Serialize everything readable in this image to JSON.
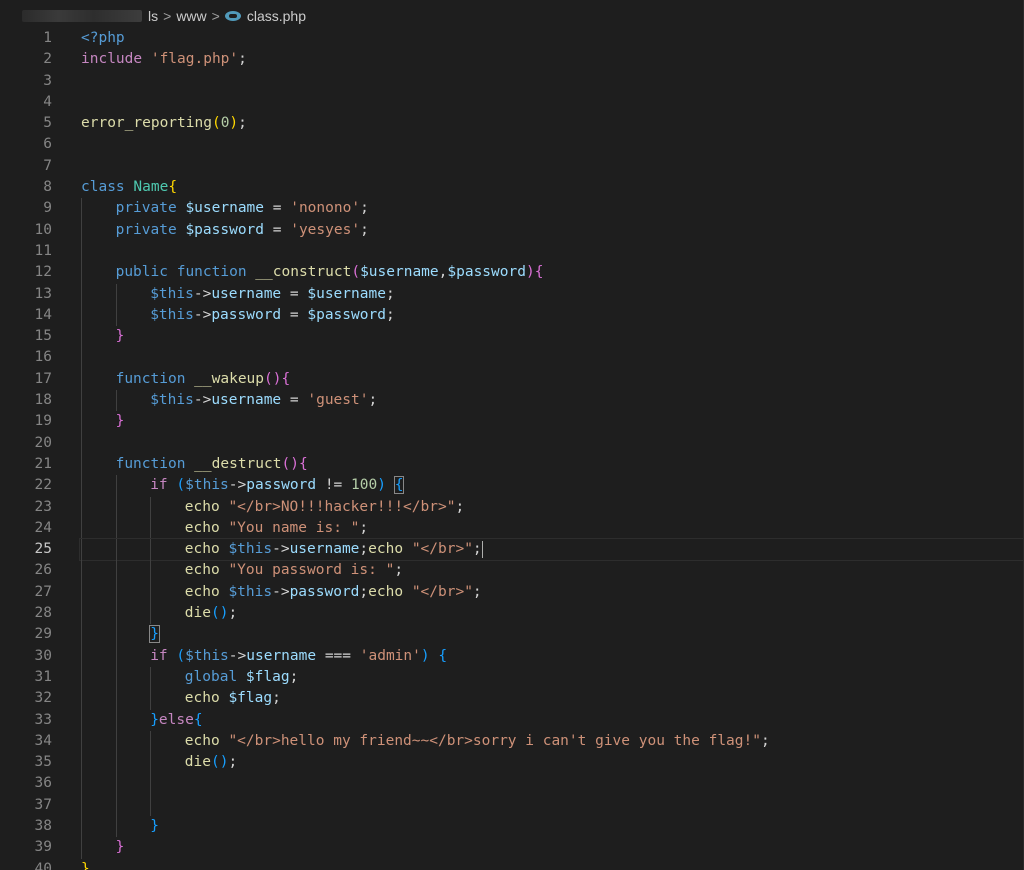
{
  "breadcrumb": {
    "segments": [
      "ls",
      "www"
    ],
    "file_icon": "php-file-icon",
    "file_name": "class.php",
    "separator": ">"
  },
  "editor": {
    "current_line": 25,
    "lines": [
      {
        "n": "1",
        "indent": 0,
        "tokens": [
          [
            "t-kw",
            "<?php"
          ]
        ]
      },
      {
        "n": "2",
        "indent": 0,
        "tokens": [
          [
            "t-ctl",
            "include"
          ],
          [
            "t-pl",
            " "
          ],
          [
            "t-str",
            "'flag.php'"
          ],
          [
            "t-pl",
            ";"
          ]
        ]
      },
      {
        "n": "3",
        "indent": 0,
        "tokens": []
      },
      {
        "n": "4",
        "indent": 0,
        "tokens": []
      },
      {
        "n": "5",
        "indent": 0,
        "tokens": [
          [
            "t-fn",
            "error_reporting"
          ],
          [
            "t-y",
            "("
          ],
          [
            "t-num",
            "0"
          ],
          [
            "t-y",
            ")"
          ],
          [
            "t-pl",
            ";"
          ]
        ]
      },
      {
        "n": "6",
        "indent": 0,
        "tokens": []
      },
      {
        "n": "7",
        "indent": 0,
        "tokens": []
      },
      {
        "n": "8",
        "indent": 0,
        "tokens": [
          [
            "t-kw",
            "class"
          ],
          [
            "t-pl",
            " "
          ],
          [
            "t-cls",
            "Name"
          ],
          [
            "t-y",
            "{"
          ]
        ]
      },
      {
        "n": "9",
        "indent": 1,
        "tokens": [
          [
            "t-kw",
            "private"
          ],
          [
            "t-pl",
            " "
          ],
          [
            "t-var",
            "$username"
          ],
          [
            "t-pl",
            " = "
          ],
          [
            "t-str",
            "'nonono'"
          ],
          [
            "t-pl",
            ";"
          ]
        ]
      },
      {
        "n": "10",
        "indent": 1,
        "tokens": [
          [
            "t-kw",
            "private"
          ],
          [
            "t-pl",
            " "
          ],
          [
            "t-var",
            "$password"
          ],
          [
            "t-pl",
            " = "
          ],
          [
            "t-str",
            "'yesyes'"
          ],
          [
            "t-pl",
            ";"
          ]
        ]
      },
      {
        "n": "11",
        "indent": 1,
        "tokens": []
      },
      {
        "n": "12",
        "indent": 1,
        "tokens": [
          [
            "t-kw",
            "public"
          ],
          [
            "t-pl",
            " "
          ],
          [
            "t-kw",
            "function"
          ],
          [
            "t-pl",
            " "
          ],
          [
            "t-fn",
            "__construct"
          ],
          [
            "t-p",
            "("
          ],
          [
            "t-var",
            "$username"
          ],
          [
            "t-pl",
            ","
          ],
          [
            "t-var",
            "$password"
          ],
          [
            "t-p",
            ")"
          ],
          [
            "t-p",
            "{"
          ]
        ]
      },
      {
        "n": "13",
        "indent": 2,
        "tokens": [
          [
            "t-kw",
            "$this"
          ],
          [
            "t-pl",
            "->"
          ],
          [
            "t-var",
            "username"
          ],
          [
            "t-pl",
            " = "
          ],
          [
            "t-var",
            "$username"
          ],
          [
            "t-pl",
            ";"
          ]
        ]
      },
      {
        "n": "14",
        "indent": 2,
        "tokens": [
          [
            "t-kw",
            "$this"
          ],
          [
            "t-pl",
            "->"
          ],
          [
            "t-var",
            "password"
          ],
          [
            "t-pl",
            " = "
          ],
          [
            "t-var",
            "$password"
          ],
          [
            "t-pl",
            ";"
          ]
        ]
      },
      {
        "n": "15",
        "indent": 1,
        "tokens": [
          [
            "t-p",
            "}"
          ]
        ]
      },
      {
        "n": "16",
        "indent": 1,
        "tokens": []
      },
      {
        "n": "17",
        "indent": 1,
        "tokens": [
          [
            "t-kw",
            "function"
          ],
          [
            "t-pl",
            " "
          ],
          [
            "t-fn",
            "__wakeup"
          ],
          [
            "t-p",
            "()"
          ],
          [
            "t-p",
            "{"
          ]
        ]
      },
      {
        "n": "18",
        "indent": 2,
        "tokens": [
          [
            "t-kw",
            "$this"
          ],
          [
            "t-pl",
            "->"
          ],
          [
            "t-var",
            "username"
          ],
          [
            "t-pl",
            " = "
          ],
          [
            "t-str",
            "'guest'"
          ],
          [
            "t-pl",
            ";"
          ]
        ]
      },
      {
        "n": "19",
        "indent": 1,
        "tokens": [
          [
            "t-p",
            "}"
          ]
        ]
      },
      {
        "n": "20",
        "indent": 1,
        "tokens": []
      },
      {
        "n": "21",
        "indent": 1,
        "tokens": [
          [
            "t-kw",
            "function"
          ],
          [
            "t-pl",
            " "
          ],
          [
            "t-fn",
            "__destruct"
          ],
          [
            "t-p",
            "()"
          ],
          [
            "t-p",
            "{"
          ]
        ]
      },
      {
        "n": "22",
        "indent": 2,
        "tokens": [
          [
            "t-ctl",
            "if"
          ],
          [
            "t-pl",
            " "
          ],
          [
            "t-b",
            "("
          ],
          [
            "t-kw",
            "$this"
          ],
          [
            "t-pl",
            "->"
          ],
          [
            "t-var",
            "password"
          ],
          [
            "t-pl",
            " != "
          ],
          [
            "t-num",
            "100"
          ],
          [
            "t-b",
            ")"
          ],
          [
            "t-pl",
            " "
          ],
          [
            "t-b bm",
            "{"
          ]
        ]
      },
      {
        "n": "23",
        "indent": 3,
        "tokens": [
          [
            "t-fn",
            "echo"
          ],
          [
            "t-pl",
            " "
          ],
          [
            "t-str",
            "\"</br>NO!!!hacker!!!</br>\""
          ],
          [
            "t-pl",
            ";"
          ]
        ]
      },
      {
        "n": "24",
        "indent": 3,
        "tokens": [
          [
            "t-fn",
            "echo"
          ],
          [
            "t-pl",
            " "
          ],
          [
            "t-str",
            "\"You name is: \""
          ],
          [
            "t-pl",
            ";"
          ]
        ]
      },
      {
        "n": "25",
        "indent": 3,
        "tokens": [
          [
            "t-fn",
            "echo"
          ],
          [
            "t-pl",
            " "
          ],
          [
            "t-kw",
            "$this"
          ],
          [
            "t-pl",
            "->"
          ],
          [
            "t-var",
            "username"
          ],
          [
            "t-pl",
            ";"
          ],
          [
            "t-fn",
            "echo"
          ],
          [
            "t-pl",
            " "
          ],
          [
            "t-str",
            "\"</br>\""
          ],
          [
            "t-pl",
            ";"
          ]
        ]
      },
      {
        "n": "26",
        "indent": 3,
        "tokens": [
          [
            "t-fn",
            "echo"
          ],
          [
            "t-pl",
            " "
          ],
          [
            "t-str",
            "\"You password is: \""
          ],
          [
            "t-pl",
            ";"
          ]
        ]
      },
      {
        "n": "27",
        "indent": 3,
        "tokens": [
          [
            "t-fn",
            "echo"
          ],
          [
            "t-pl",
            " "
          ],
          [
            "t-kw",
            "$this"
          ],
          [
            "t-pl",
            "->"
          ],
          [
            "t-var",
            "password"
          ],
          [
            "t-pl",
            ";"
          ],
          [
            "t-fn",
            "echo"
          ],
          [
            "t-pl",
            " "
          ],
          [
            "t-str",
            "\"</br>\""
          ],
          [
            "t-pl",
            ";"
          ]
        ]
      },
      {
        "n": "28",
        "indent": 3,
        "tokens": [
          [
            "t-fn",
            "die"
          ],
          [
            "t-b",
            "()"
          ],
          [
            "t-pl",
            ";"
          ]
        ]
      },
      {
        "n": "29",
        "indent": 2,
        "tokens": [
          [
            "t-b bm",
            "}"
          ]
        ]
      },
      {
        "n": "30",
        "indent": 2,
        "tokens": [
          [
            "t-ctl",
            "if"
          ],
          [
            "t-pl",
            " "
          ],
          [
            "t-b",
            "("
          ],
          [
            "t-kw",
            "$this"
          ],
          [
            "t-pl",
            "->"
          ],
          [
            "t-var",
            "username"
          ],
          [
            "t-pl",
            " === "
          ],
          [
            "t-str",
            "'admin'"
          ],
          [
            "t-b",
            ")"
          ],
          [
            "t-pl",
            " "
          ],
          [
            "t-b",
            "{"
          ]
        ]
      },
      {
        "n": "31",
        "indent": 3,
        "tokens": [
          [
            "t-kw",
            "global"
          ],
          [
            "t-pl",
            " "
          ],
          [
            "t-var",
            "$flag"
          ],
          [
            "t-pl",
            ";"
          ]
        ]
      },
      {
        "n": "32",
        "indent": 3,
        "tokens": [
          [
            "t-fn",
            "echo"
          ],
          [
            "t-pl",
            " "
          ],
          [
            "t-var",
            "$flag"
          ],
          [
            "t-pl",
            ";"
          ]
        ]
      },
      {
        "n": "33",
        "indent": 2,
        "tokens": [
          [
            "t-b",
            "}"
          ],
          [
            "t-ctl",
            "else"
          ],
          [
            "t-b",
            "{"
          ]
        ]
      },
      {
        "n": "34",
        "indent": 3,
        "tokens": [
          [
            "t-fn",
            "echo"
          ],
          [
            "t-pl",
            " "
          ],
          [
            "t-str",
            "\"</br>hello my friend~~</br>sorry i can't give you the flag!\""
          ],
          [
            "t-pl",
            ";"
          ]
        ]
      },
      {
        "n": "35",
        "indent": 3,
        "tokens": [
          [
            "t-fn",
            "die"
          ],
          [
            "t-b",
            "()"
          ],
          [
            "t-pl",
            ";"
          ]
        ]
      },
      {
        "n": "36",
        "indent": 3,
        "tokens": []
      },
      {
        "n": "37",
        "indent": 3,
        "tokens": []
      },
      {
        "n": "38",
        "indent": 2,
        "tokens": [
          [
            "t-b",
            "}"
          ]
        ]
      },
      {
        "n": "39",
        "indent": 1,
        "tokens": [
          [
            "t-p",
            "}"
          ]
        ]
      },
      {
        "n": "40",
        "indent": 0,
        "tokens": [
          [
            "t-y",
            "}"
          ]
        ]
      }
    ]
  }
}
